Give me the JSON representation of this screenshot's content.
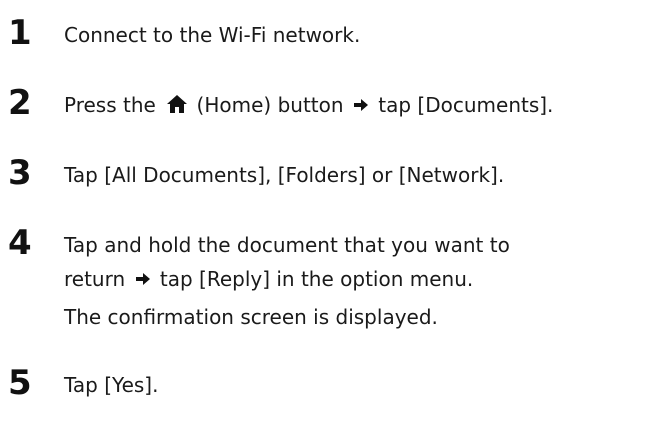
{
  "steps": [
    {
      "number": "1",
      "text": "Connect to the Wi-Fi network."
    },
    {
      "number": "2",
      "text_before_icon": "Press the",
      "text_after_icon": "(Home) button",
      "text_after_arrow": "tap [Documents].",
      "icon": "home-icon",
      "arrow_icon": "right-arrow-icon"
    },
    {
      "number": "3",
      "text": "Tap [All Documents], [Folders] or [Network]."
    },
    {
      "number": "4",
      "line1": "Tap and hold the document that you want to",
      "line2_before_arrow": "return",
      "line2_after_arrow": "tap [Reply] in the option menu.",
      "arrow_icon": "right-arrow-icon",
      "note": "The confirmation screen is displayed."
    },
    {
      "number": "5",
      "text": "Tap [Yes]."
    }
  ]
}
